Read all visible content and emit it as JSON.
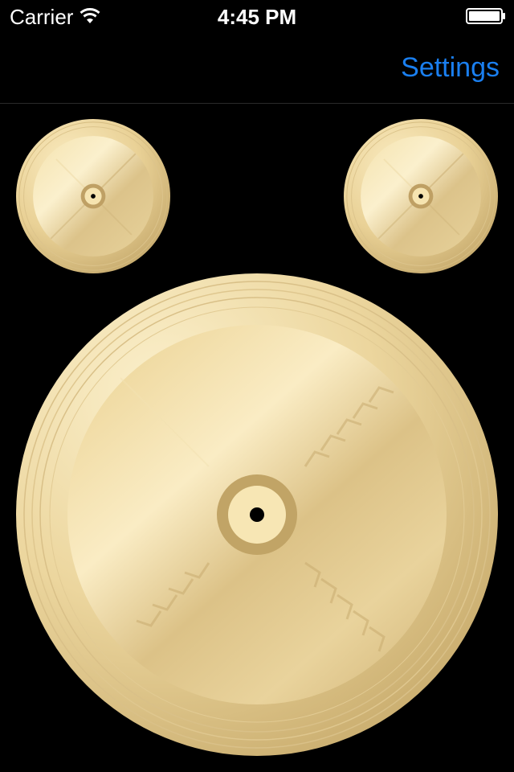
{
  "status_bar": {
    "carrier": "Carrier",
    "time": "4:45 PM",
    "wifi_icon": "wifi-icon",
    "battery_icon": "battery-full-icon"
  },
  "nav": {
    "settings_label": "Settings",
    "accent_color": "#1a7ff0"
  },
  "cymbals": [
    {
      "id": "left-small",
      "icon": "cymbal-icon"
    },
    {
      "id": "right-small",
      "icon": "cymbal-icon"
    },
    {
      "id": "main-large",
      "icon": "cymbal-icon"
    }
  ],
  "colors": {
    "background": "#000000",
    "cymbal_gold_light": "#f7e5b0",
    "cymbal_gold_mid": "#e6cc8c",
    "cymbal_gold_dark": "#b89a5e"
  }
}
